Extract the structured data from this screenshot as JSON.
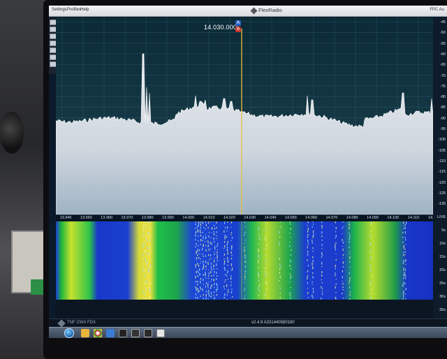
{
  "menu": {
    "settings": "Settings",
    "profiles": "Profiles",
    "help": "Help"
  },
  "app": {
    "title": "FlexRadio",
    "right_label": "FPC Au"
  },
  "panadapter": {
    "frequency": "14.030.000",
    "marker_a": "A",
    "marker_b": "B",
    "dbm_ticks": [
      "-45",
      "-50",
      "-55",
      "-60",
      "-65",
      "-70",
      "-75",
      "-80",
      "-85",
      "-90",
      "-95",
      "-100",
      "-105",
      "-110",
      "-115",
      "-120",
      "-125",
      "-130"
    ],
    "freq_ticks": [
      "13.940",
      "13.950",
      "13.960",
      "13.970",
      "13.980",
      "13.990",
      "14.000",
      "14.010",
      "14.020",
      "14.030",
      "14.040",
      "14.050",
      "14.060",
      "14.070",
      "14.080",
      "14.090",
      "14.100",
      "14.110",
      "14.120"
    ]
  },
  "waterfall": {
    "time_ticks": [
      "LIVE",
      "5s",
      "10s",
      "15s",
      "20s",
      "25s",
      "30s",
      "35s"
    ]
  },
  "status": {
    "left": "TNF CWX FDX",
    "version": "v2.4.9   A331440580180"
  },
  "colors": {
    "spectrum_fill": "#d8dde3",
    "cursor": "#e8c13a",
    "waterfall_base": "#1733c8",
    "waterfall_hot": "#c8e62e"
  }
}
